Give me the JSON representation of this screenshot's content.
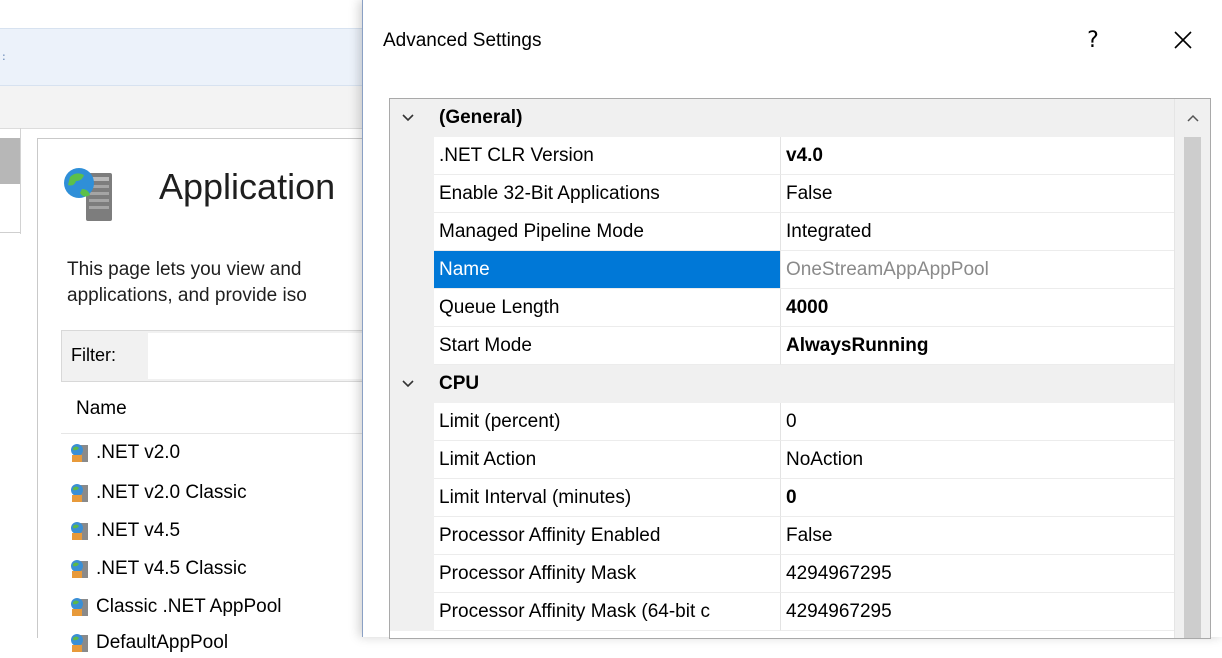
{
  "background": {
    "page_title": "Application",
    "description_lines": [
      "This page lets you view and",
      "applications, and provide iso"
    ],
    "filter_label": "Filter:",
    "list_header": "Name",
    "pools": [
      ".NET v2.0",
      ".NET v2.0 Classic",
      ".NET v4.5",
      ".NET v4.5 Classic",
      "Classic .NET AppPool",
      "DefaultAppPool"
    ]
  },
  "dialog": {
    "title": "Advanced Settings",
    "help_label": "?",
    "general": {
      "label": "(General)",
      "rows": [
        {
          "name": ".NET CLR Version",
          "value": "v4.0"
        },
        {
          "name": "Enable 32-Bit Applications",
          "value": "False"
        },
        {
          "name": "Managed Pipeline Mode",
          "value": "Integrated"
        },
        {
          "name": "Name",
          "value": "OneStreamAppAppPool"
        },
        {
          "name": "Queue Length",
          "value": "4000"
        },
        {
          "name": "Start Mode",
          "value": "AlwaysRunning"
        }
      ]
    },
    "cpu": {
      "label": "CPU",
      "rows": [
        {
          "name": "Limit (percent)",
          "value": "0"
        },
        {
          "name": "Limit Action",
          "value": "NoAction"
        },
        {
          "name": "Limit Interval (minutes)",
          "value": "0"
        },
        {
          "name": "Processor Affinity Enabled",
          "value": "False"
        },
        {
          "name": "Processor Affinity Mask",
          "value": "4294967295"
        },
        {
          "name": "Processor Affinity Mask (64-bit c",
          "value": "4294967295"
        }
      ]
    }
  },
  "colors": {
    "selection": "#0078d7",
    "category_bg": "#f0f0f0",
    "dialog_border": "#8aa0c4"
  },
  "icons": [
    "app-pools-icon",
    "pool-icon",
    "help-icon",
    "close-icon",
    "chevron-down-icon",
    "scroll-up-arrow-icon"
  ]
}
